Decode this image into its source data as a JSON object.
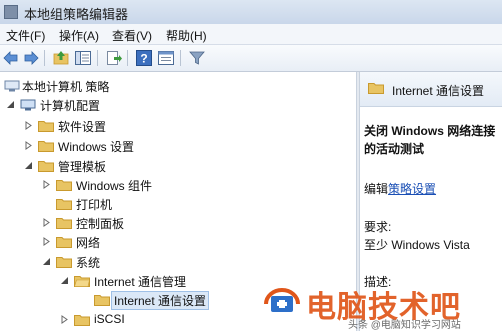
{
  "window": {
    "title": "本地组策略编辑器"
  },
  "menubar": [
    "文件(F)",
    "操作(A)",
    "查看(V)",
    "帮助(H)"
  ],
  "toolbar": {
    "icons": [
      "back-arrow-icon",
      "forward-arrow-icon",
      "up-folder-icon",
      "show-hide-tree-icon",
      "export-list-icon",
      "help-icon",
      "properties-icon",
      "filter-icon"
    ]
  },
  "tree": {
    "root": "本地计算机 策略",
    "computer_config": "计算机配置",
    "software_settings": "软件设置",
    "windows_settings": "Windows 设置",
    "admin_templates": "管理模板",
    "windows_components": "Windows 组件",
    "printers": "打印机",
    "control_panel": "控制面板",
    "network": "网络",
    "system": "系统",
    "internet_comm_mgmt": "Internet 通信管理",
    "internet_comm_settings": "Internet 通信设置",
    "iscsi": "iSCSI"
  },
  "right_pane": {
    "header": "Internet 通信设置",
    "policy_title_line1": "关闭 Windows 网络连接",
    "policy_title_line2": "的活动测试",
    "edit_prefix": "编辑",
    "edit_link": "策略设置",
    "requirements_label": "要求:",
    "requirements_value": "至少 Windows Vista",
    "description_label": "描述:"
  },
  "watermark": {
    "main": "电脑技术吧",
    "sub": "头条 @电脑知识学习网站"
  },
  "colors": {
    "folder": "#e8c463",
    "folder_dark": "#c99a2e",
    "selection": "#dbe8f7",
    "link": "#1a4fb5",
    "watermark": "#e0561a"
  }
}
